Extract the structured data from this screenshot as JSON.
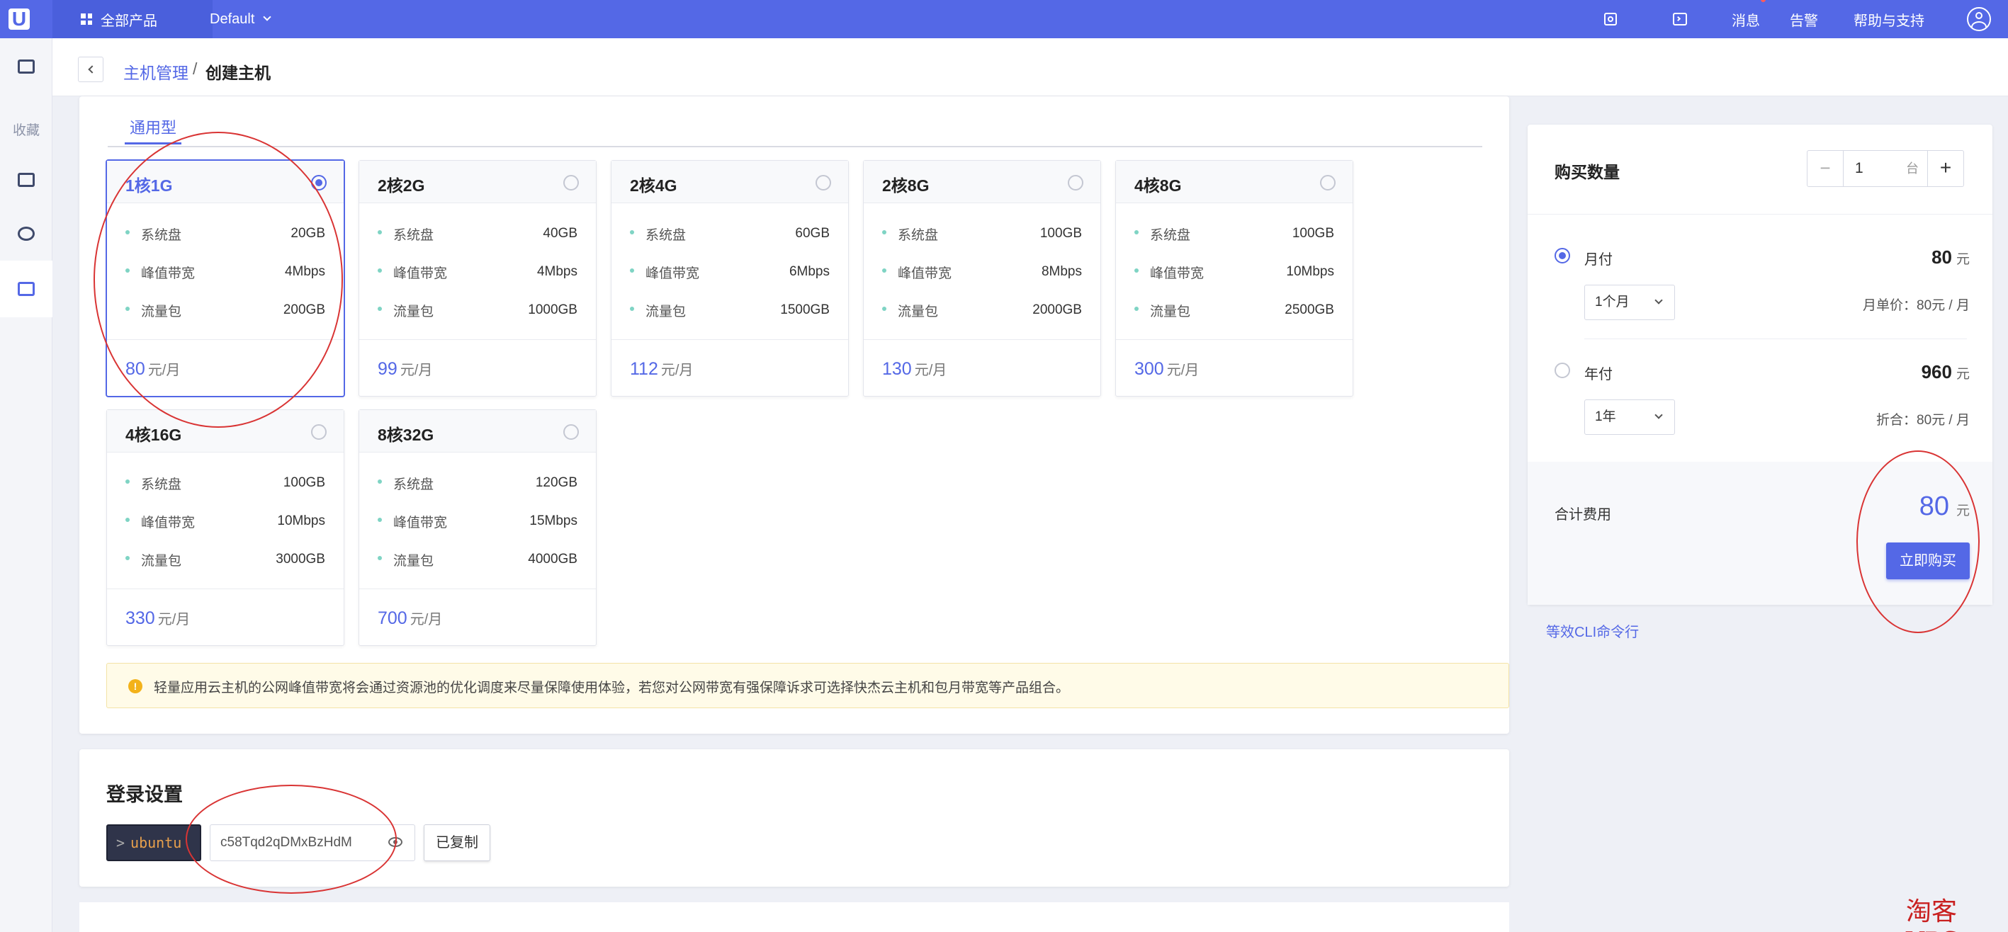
{
  "topbar": {
    "logo_letter": "U",
    "all_products": "全部产品",
    "project": "Default",
    "icons": [
      "search-icon",
      "terminal-icon"
    ],
    "message": "消息",
    "alarm": "告警",
    "help": "帮助与支持",
    "brand_color": "#5468e6"
  },
  "sidebar": {
    "favorites_label": "收藏",
    "icons": [
      "message-icon",
      "host-icon",
      "network-icon",
      "lighthost-icon"
    ]
  },
  "breadcrumb": {
    "parent": "主机管理",
    "separator": "/",
    "current": "创建主机"
  },
  "tabs": {
    "general": "通用型"
  },
  "specs": [
    {
      "name": "1核1G",
      "selected": true,
      "rows": [
        {
          "label": "系统盘",
          "value": "20GB"
        },
        {
          "label": "峰值带宽",
          "value": "4Mbps"
        },
        {
          "label": "流量包",
          "value": "200GB"
        }
      ],
      "price": "80",
      "unit": "元/月"
    },
    {
      "name": "2核2G",
      "selected": false,
      "rows": [
        {
          "label": "系统盘",
          "value": "40GB"
        },
        {
          "label": "峰值带宽",
          "value": "4Mbps"
        },
        {
          "label": "流量包",
          "value": "1000GB"
        }
      ],
      "price": "99",
      "unit": "元/月"
    },
    {
      "name": "2核4G",
      "selected": false,
      "rows": [
        {
          "label": "系统盘",
          "value": "60GB"
        },
        {
          "label": "峰值带宽",
          "value": "6Mbps"
        },
        {
          "label": "流量包",
          "value": "1500GB"
        }
      ],
      "price": "112",
      "unit": "元/月"
    },
    {
      "name": "2核8G",
      "selected": false,
      "rows": [
        {
          "label": "系统盘",
          "value": "100GB"
        },
        {
          "label": "峰值带宽",
          "value": "8Mbps"
        },
        {
          "label": "流量包",
          "value": "2000GB"
        }
      ],
      "price": "130",
      "unit": "元/月"
    },
    {
      "name": "4核8G",
      "selected": false,
      "rows": [
        {
          "label": "系统盘",
          "value": "100GB"
        },
        {
          "label": "峰值带宽",
          "value": "10Mbps"
        },
        {
          "label": "流量包",
          "value": "2500GB"
        }
      ],
      "price": "300",
      "unit": "元/月"
    },
    {
      "name": "4核16G",
      "selected": false,
      "rows": [
        {
          "label": "系统盘",
          "value": "100GB"
        },
        {
          "label": "峰值带宽",
          "value": "10Mbps"
        },
        {
          "label": "流量包",
          "value": "3000GB"
        }
      ],
      "price": "330",
      "unit": "元/月"
    },
    {
      "name": "8核32G",
      "selected": false,
      "rows": [
        {
          "label": "系统盘",
          "value": "120GB"
        },
        {
          "label": "峰值带宽",
          "value": "15Mbps"
        },
        {
          "label": "流量包",
          "value": "4000GB"
        }
      ],
      "price": "700",
      "unit": "元/月"
    }
  ],
  "notice": {
    "icon": "!",
    "text": "轻量应用云主机的公网峰值带宽将会通过资源池的优化调度来尽量保障使用体验，若您对公网带宽有强保障诉求可选择快杰云主机和包月带宽等产品组合。"
  },
  "login": {
    "title": "登录设置",
    "prompt": ">",
    "username": "ubuntu",
    "password": "c58Tqd2qDMxBzHdM",
    "copy_button": "已复制"
  },
  "purchase": {
    "title": "购买数量",
    "quantity": "1",
    "quantity_unit": "台",
    "minus": "−",
    "plus": "+",
    "monthly": {
      "label": "月付",
      "amount": "80",
      "currency": "元",
      "duration": "1个月",
      "unit_price": "月单价：80元 / 月",
      "selected": true
    },
    "yearly": {
      "label": "年付",
      "amount": "960",
      "currency": "元",
      "duration": "1年",
      "unit_price": "折合：80元 / 月",
      "selected": false
    },
    "total_label": "合计费用",
    "total_amount": "80",
    "total_currency": "元",
    "buy_button": "立即购买"
  },
  "cli_link": "等效CLI命令行",
  "watermark": "淘客VPS"
}
